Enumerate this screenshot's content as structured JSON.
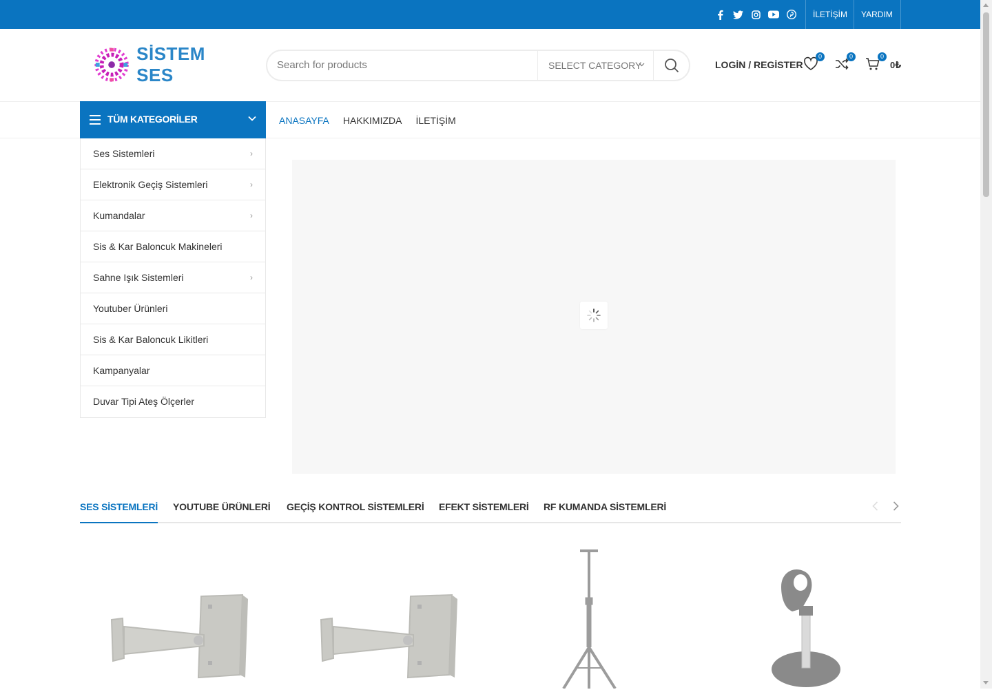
{
  "topbar": {
    "social_icons": [
      "facebook-icon",
      "twitter-icon",
      "instagram-icon",
      "youtube-icon",
      "pinterest-icon"
    ],
    "links": [
      "İLETİŞİM",
      "YARDIM"
    ],
    "bg_color": "#0a74c0"
  },
  "header": {
    "logo_text": "SİSTEM SES",
    "search": {
      "placeholder": "Search for products",
      "category_label": "SELECT CATEGORY"
    },
    "account_label": "LOGİN / REGİSTER",
    "wishlist_count": "0",
    "compare_count": "0",
    "cart_count": "0",
    "cart_total": "0₺"
  },
  "nav": {
    "categories_button": "TÜM KATEGORİLER",
    "links": [
      "ANASAYFA",
      "HAKKIMIZDA",
      "İLETİŞİM"
    ]
  },
  "categories": [
    {
      "label": "Ses Sistemleri",
      "has_sub": true
    },
    {
      "label": "Elektronik Geçiş Sistemleri",
      "has_sub": true
    },
    {
      "label": "Kumandalar",
      "has_sub": true
    },
    {
      "label": "Sis & Kar Baloncuk Makineleri",
      "has_sub": false
    },
    {
      "label": "Sahne Işık Sistemleri",
      "has_sub": true
    },
    {
      "label": "Youtuber Ürünleri",
      "has_sub": false
    },
    {
      "label": "Sis & Kar Baloncuk Likitleri",
      "has_sub": false
    },
    {
      "label": "Kampanyalar",
      "has_sub": false
    },
    {
      "label": "Duvar Tipi Ateş Ölçerler",
      "has_sub": false
    }
  ],
  "product_tabs": [
    "SES SİSTEMLERİ",
    "YOUTUBE ÜRÜNLERİ",
    "GEÇİŞ KONTROL SİSTEMLERİ",
    "EFEKT SİSTEMLERİ",
    "RF KUMANDA SİSTEMLERİ"
  ],
  "products": [
    {
      "image": "wall-bracket-image"
    },
    {
      "image": "wall-bracket-image"
    },
    {
      "image": "speaker-stand-image"
    },
    {
      "image": "microphone-stand-image"
    }
  ],
  "colors": {
    "accent": "#0a74c0"
  }
}
